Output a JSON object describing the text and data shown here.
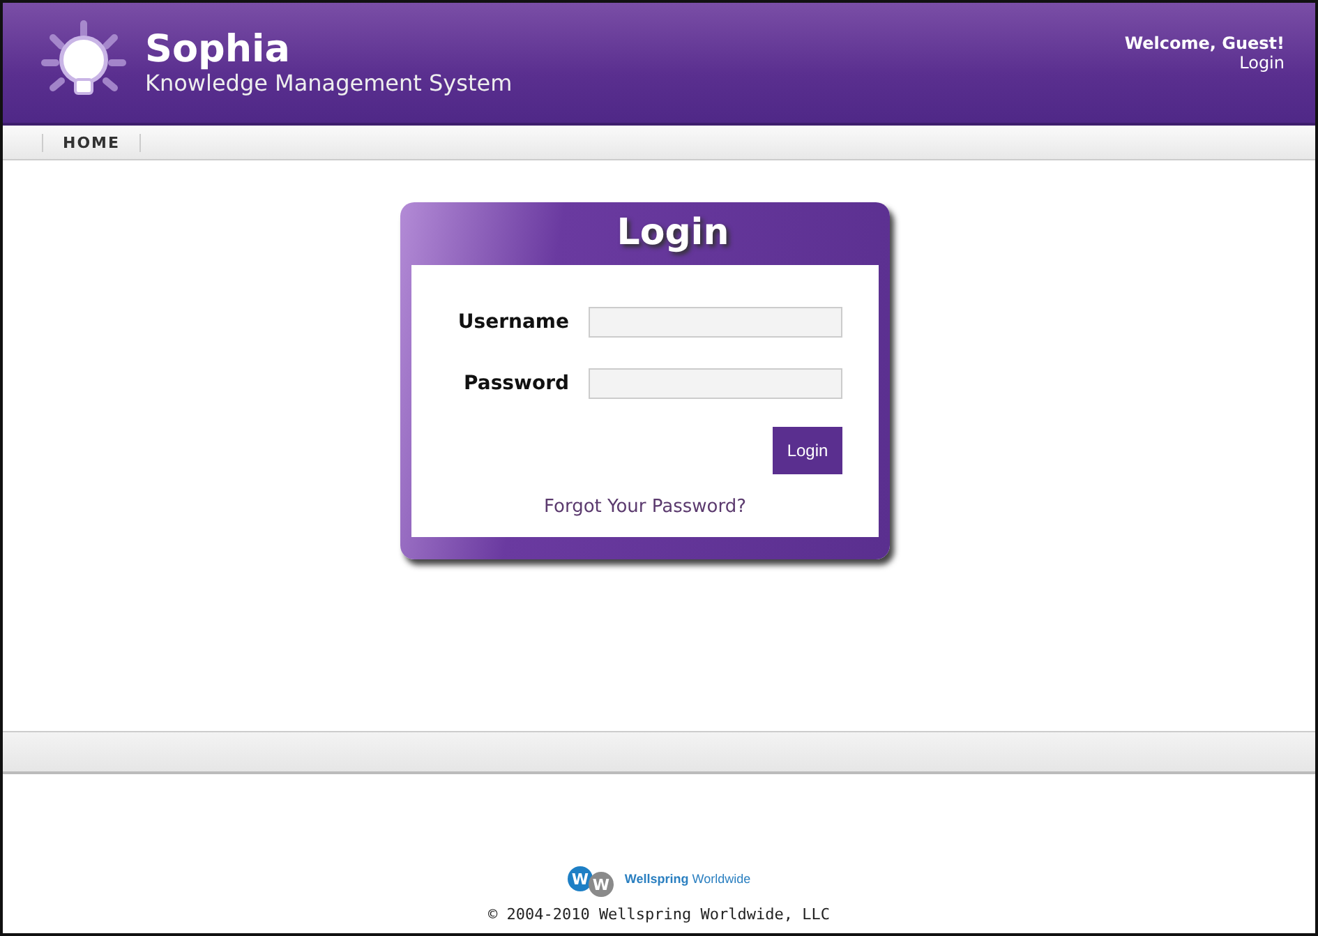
{
  "header": {
    "title": "Sophia",
    "subtitle": "Knowledge Management System",
    "welcome": "Welcome, Guest!",
    "login_link": "Login"
  },
  "nav": [
    {
      "label": "HOME",
      "selected": false
    }
  ],
  "login_box": {
    "title": "Login",
    "fields": [
      {
        "label": "Username"
      },
      {
        "label": "Password"
      }
    ],
    "button": "Login",
    "forgot_link": "Forgot Your Password?"
  },
  "footer": {
    "logo_letters": [
      "W",
      "W"
    ],
    "brand": "**Wellspring** Worldwide",
    "copyright": "© 2004-2010 Wellspring Worldwide, LLC"
  }
}
